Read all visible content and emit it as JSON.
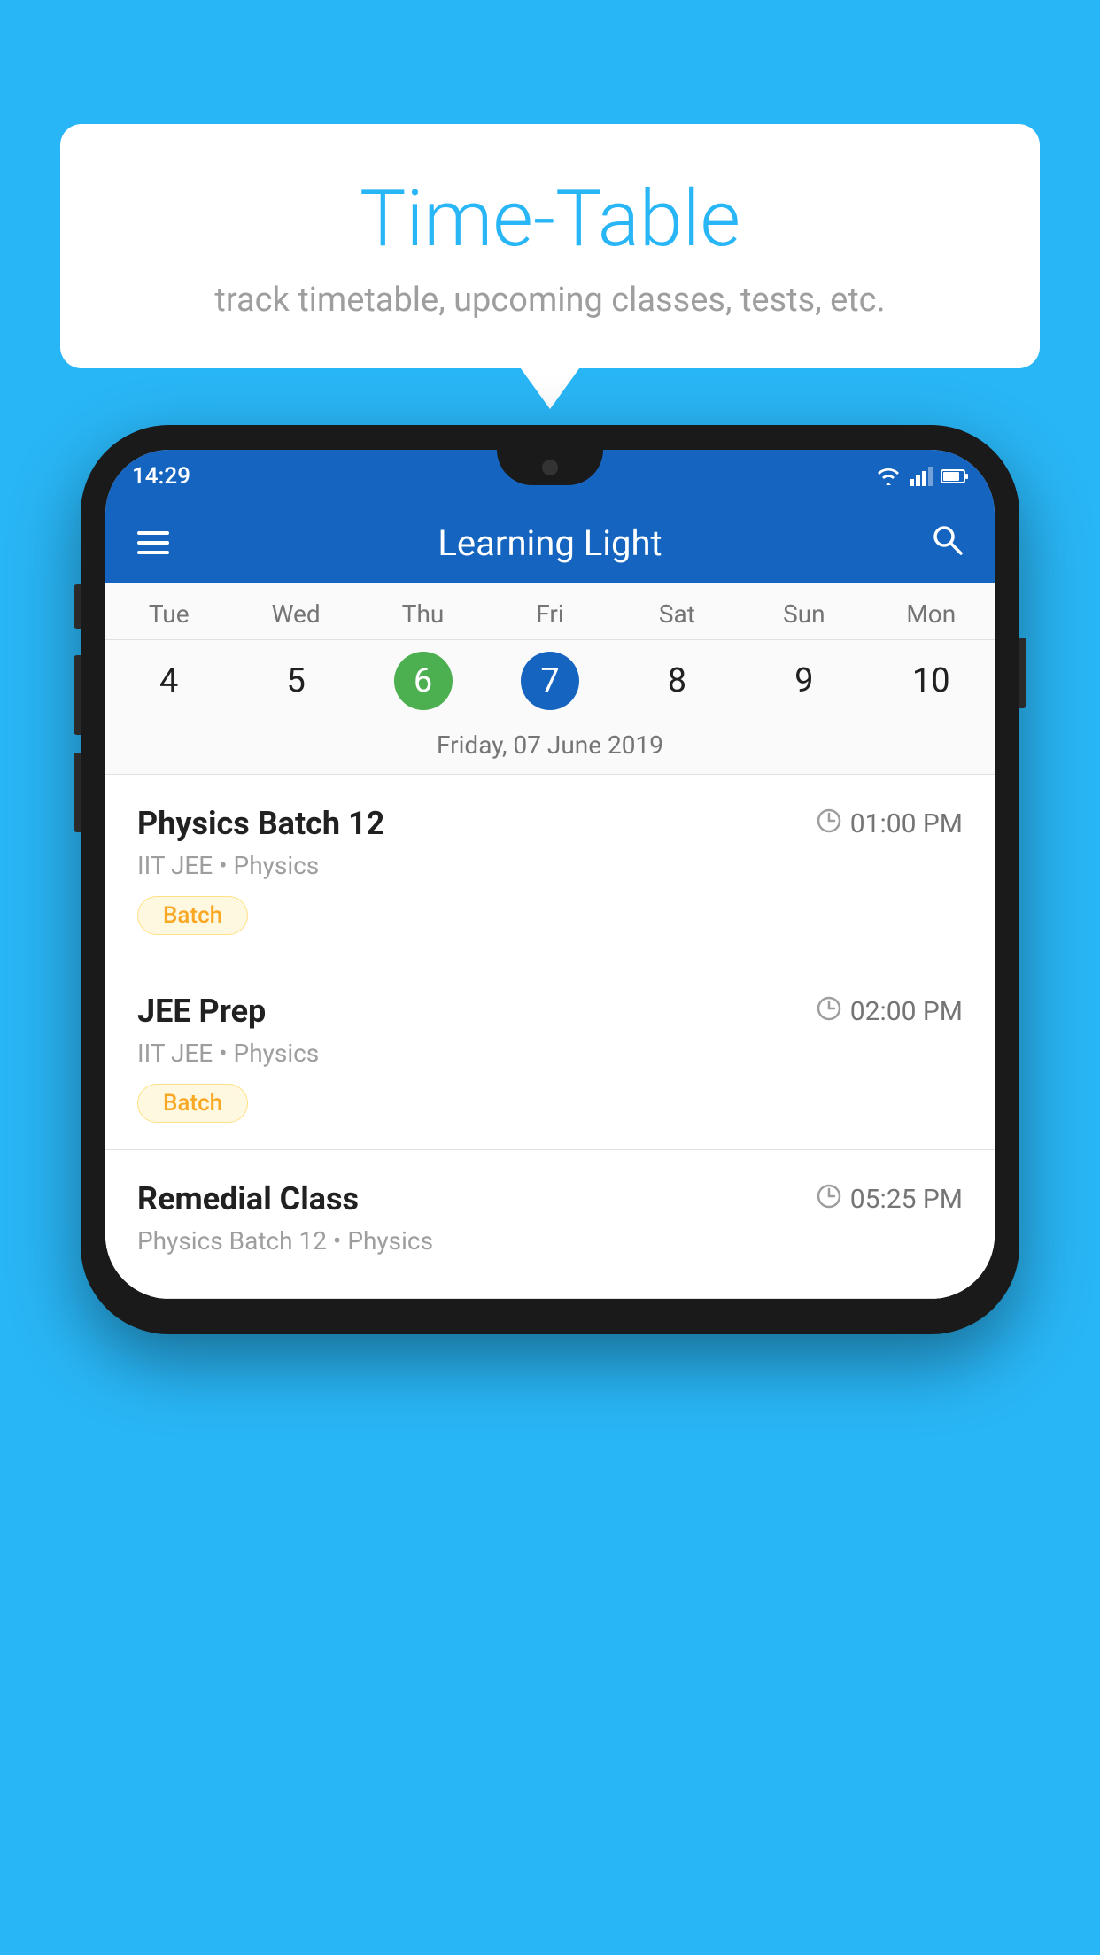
{
  "background_color": "#29B6F6",
  "bubble": {
    "title": "Time-Table",
    "subtitle": "track timetable, upcoming classes, tests, etc."
  },
  "phone": {
    "status_bar": {
      "time": "14:29",
      "icons": [
        "wifi",
        "signal",
        "battery"
      ]
    },
    "app_bar": {
      "title": "Learning Light",
      "menu_icon": "≡",
      "search_icon": "🔍"
    },
    "calendar": {
      "days_of_week": [
        "Tue",
        "Wed",
        "Thu",
        "Fri",
        "Sat",
        "Sun",
        "Mon"
      ],
      "dates": [
        "4",
        "5",
        "6",
        "7",
        "8",
        "9",
        "10"
      ],
      "today_index": 2,
      "selected_index": 3,
      "selected_label": "Friday, 07 June 2019"
    },
    "schedule": [
      {
        "title": "Physics Batch 12",
        "time": "01:00 PM",
        "subtitle": "IIT JEE • Physics",
        "tag": "Batch"
      },
      {
        "title": "JEE Prep",
        "time": "02:00 PM",
        "subtitle": "IIT JEE • Physics",
        "tag": "Batch"
      },
      {
        "title": "Remedial Class",
        "time": "05:25 PM",
        "subtitle": "Physics Batch 12 • Physics",
        "tag": null
      }
    ]
  }
}
